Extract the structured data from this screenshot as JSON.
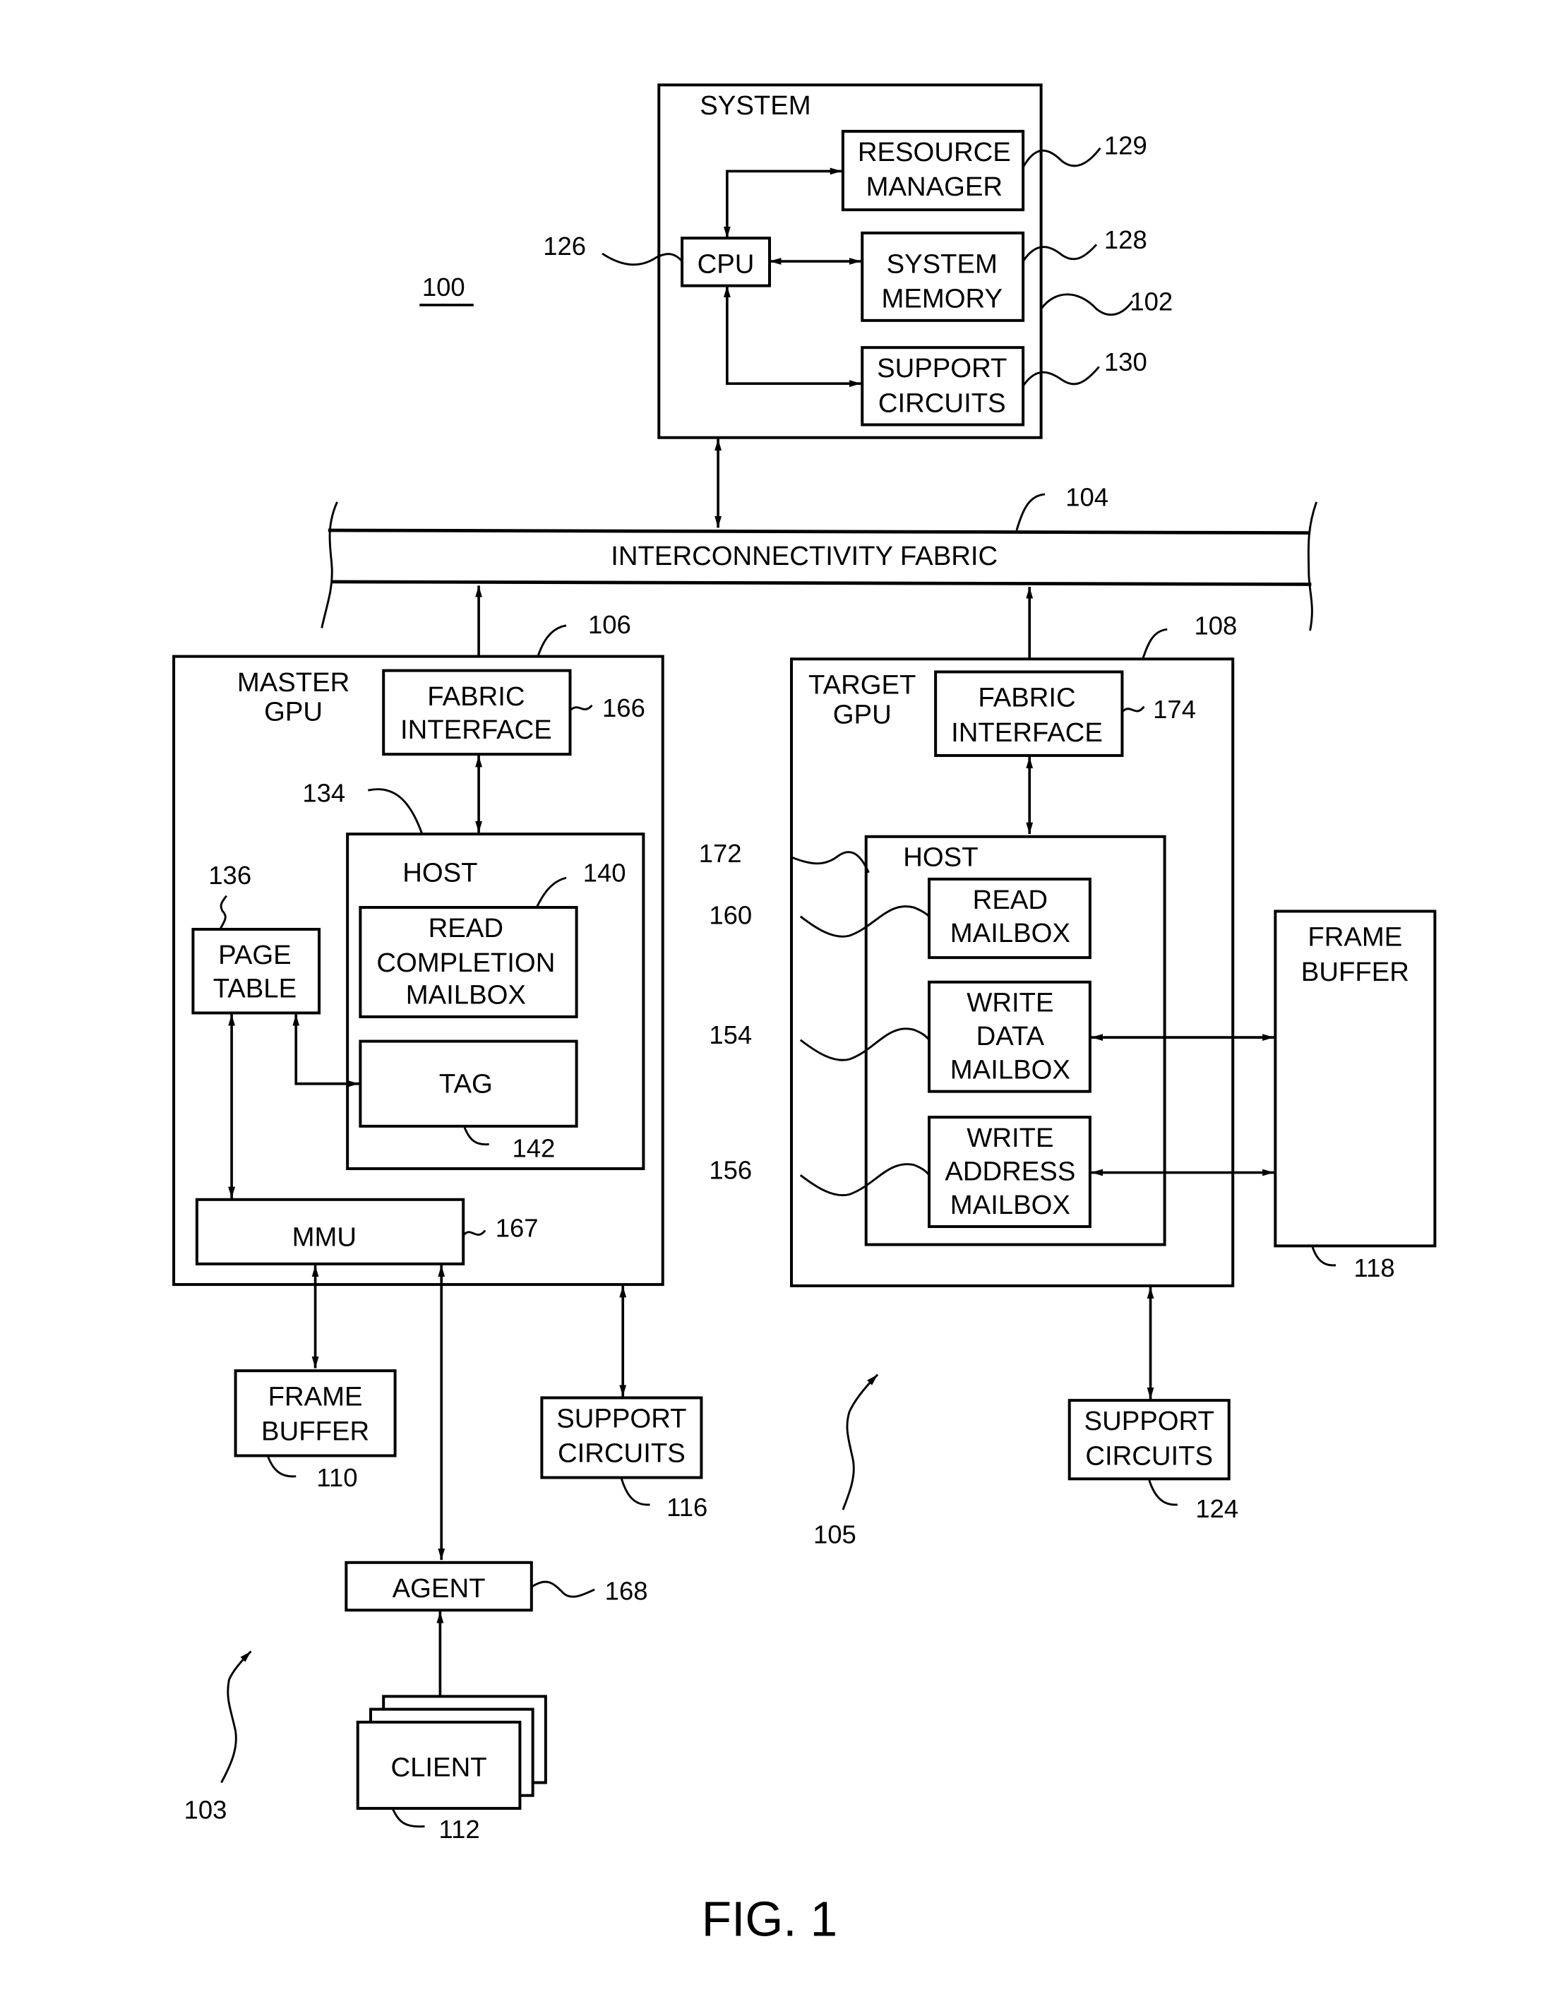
{
  "figure": {
    "caption": "FIG. 1",
    "overall_ref": "100",
    "system_ref_103": "103",
    "system_ref_105": "105"
  },
  "system": {
    "title": "SYSTEM",
    "ref": "102",
    "cpu": {
      "label": "CPU",
      "ref": "126"
    },
    "resource_manager": {
      "line1": "RESOURCE",
      "line2": "MANAGER",
      "ref": "129"
    },
    "system_memory": {
      "line1": "SYSTEM",
      "line2": "MEMORY",
      "ref": "128"
    },
    "support_circuits": {
      "line1": "SUPPORT",
      "line2": "CIRCUITS",
      "ref": "130"
    }
  },
  "fabric": {
    "label": "INTERCONNECTIVITY FABRIC",
    "ref": "104"
  },
  "master_gpu": {
    "title_line1": "MASTER",
    "title_line2": "GPU",
    "ref": "106",
    "fabric_interface": {
      "line1": "FABRIC",
      "line2": "INTERFACE",
      "ref": "166"
    },
    "host": {
      "label": "HOST",
      "ref": "134"
    },
    "read_completion_mailbox": {
      "line1": "READ",
      "line2": "COMPLETION",
      "line3": "MAILBOX",
      "ref": "140"
    },
    "tag": {
      "label": "TAG",
      "ref": "142"
    },
    "page_table": {
      "line1": "PAGE",
      "line2": "TABLE",
      "ref": "136"
    },
    "mmu": {
      "label": "MMU",
      "ref": "167"
    }
  },
  "master_peripherals": {
    "frame_buffer": {
      "line1": "FRAME",
      "line2": "BUFFER",
      "ref": "110"
    },
    "support_circuits": {
      "line1": "SUPPORT",
      "line2": "CIRCUITS",
      "ref": "116"
    },
    "agent": {
      "label": "AGENT",
      "ref": "168"
    },
    "client": {
      "label": "CLIENT",
      "ref": "112"
    }
  },
  "target_gpu": {
    "title_line1": "TARGET",
    "title_line2": "GPU",
    "ref": "108",
    "fabric_interface": {
      "line1": "FABRIC",
      "line2": "INTERFACE",
      "ref": "174"
    },
    "host": {
      "label": "HOST",
      "ref": "172"
    },
    "read_mailbox": {
      "line1": "READ",
      "line2": "MAILBOX",
      "ref": "160"
    },
    "write_data_mailbox": {
      "line1": "WRITE",
      "line2": "DATA",
      "line3": "MAILBOX",
      "ref": "154"
    },
    "write_address_mailbox": {
      "line1": "WRITE",
      "line2": "ADDRESS",
      "line3": "MAILBOX",
      "ref": "156"
    }
  },
  "target_peripherals": {
    "frame_buffer": {
      "line1": "FRAME",
      "line2": "BUFFER",
      "ref": "118"
    },
    "support_circuits": {
      "line1": "SUPPORT",
      "line2": "CIRCUITS",
      "ref": "124"
    }
  }
}
